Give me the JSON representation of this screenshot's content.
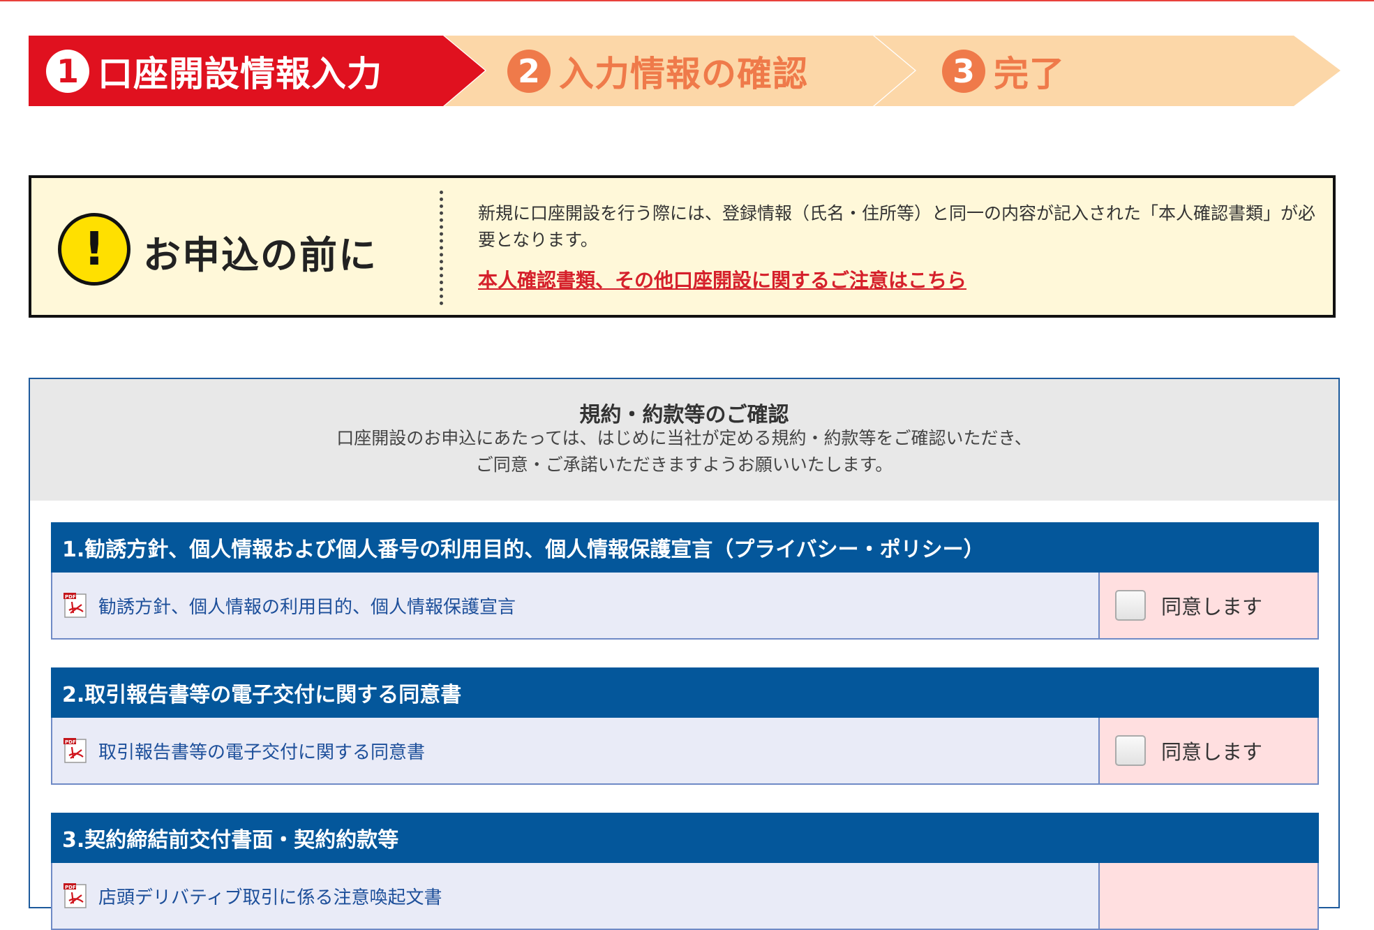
{
  "steps": [
    {
      "number": "1",
      "label": "口座開設情報入力",
      "state": "current"
    },
    {
      "number": "2",
      "label": "入力情報の確認",
      "state": "upcoming"
    },
    {
      "number": "3",
      "label": "完了",
      "state": "upcoming"
    }
  ],
  "notice": {
    "icon": "exclamation-icon",
    "title": "お申込の前に",
    "body": "新規に口座開設を行う際には、登録情報（氏名・住所等）と同一の内容が記入された「本人確認書類」が必要となります。",
    "link": "本人確認書類、その他口座開設に関するご注意はこちら"
  },
  "terms": {
    "title": "規約・約款等のご確認",
    "desc_line1": "口座開設のお申込にあたっては、はじめに当社が定める規約・約款等をご確認いただき、",
    "desc_line2": "ご同意・ご承諾いただきますようお願いいたします。",
    "sections": [
      {
        "title": "1.勧誘方針、個人情報および個人番号の利用目的、個人情報保護宣言（プライバシー・ポリシー）",
        "document": "勧誘方針、個人情報の利用目的、個人情報保護宣言",
        "agree_label": "同意します",
        "checked": false
      },
      {
        "title": "2.取引報告書等の電子交付に関する同意書",
        "document": "取引報告書等の電子交付に関する同意書",
        "agree_label": "同意します",
        "checked": false
      },
      {
        "title": "3.契約締結前交付書面・契約約款等",
        "document": "店頭デリバティブ取引に係る注意喚起文書",
        "agree_label": "",
        "checked": false
      }
    ]
  },
  "colors": {
    "current_step": "#e0111f",
    "upcoming_step": "#fcd7a8",
    "step_accent": "#ef7a4a",
    "section_header": "#04579b",
    "link": "#d5202b",
    "notice_bg": "#fff8d9",
    "agree_bg": "#ffdfe0"
  }
}
